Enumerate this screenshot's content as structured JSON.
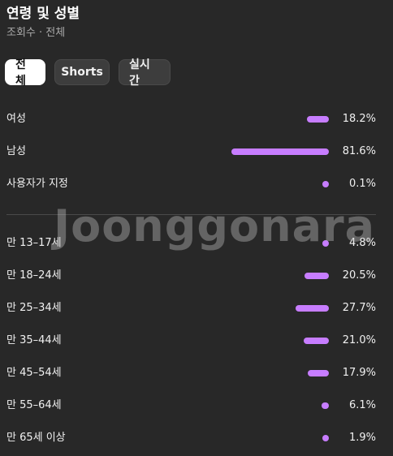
{
  "header": {
    "title": "연령 및 성별",
    "subtitle": "조회수 · 전체"
  },
  "tabs": [
    {
      "label": "전체",
      "active": true
    },
    {
      "label": "Shorts",
      "active": false
    },
    {
      "label": "실시간",
      "active": false
    }
  ],
  "gender": [
    {
      "label": "여성",
      "percent": 18.2,
      "value": "18.2%"
    },
    {
      "label": "남성",
      "percent": 81.6,
      "value": "81.6%"
    },
    {
      "label": "사용자가 지정",
      "percent": 0.1,
      "value": "0.1%"
    }
  ],
  "age": [
    {
      "label": "만 13–17세",
      "percent": 4.8,
      "value": "4.8%"
    },
    {
      "label": "만 18–24세",
      "percent": 20.5,
      "value": "20.5%"
    },
    {
      "label": "만 25–34세",
      "percent": 27.7,
      "value": "27.7%"
    },
    {
      "label": "만 35–44세",
      "percent": 21.0,
      "value": "21.0%"
    },
    {
      "label": "만 45–54세",
      "percent": 17.9,
      "value": "17.9%"
    },
    {
      "label": "만 55–64세",
      "percent": 6.1,
      "value": "6.1%"
    },
    {
      "label": "만 65세 이상",
      "percent": 1.9,
      "value": "1.9%"
    }
  ],
  "watermark": "Joonggonara",
  "colors": {
    "bar": "#c77dff",
    "background": "#282828"
  }
}
